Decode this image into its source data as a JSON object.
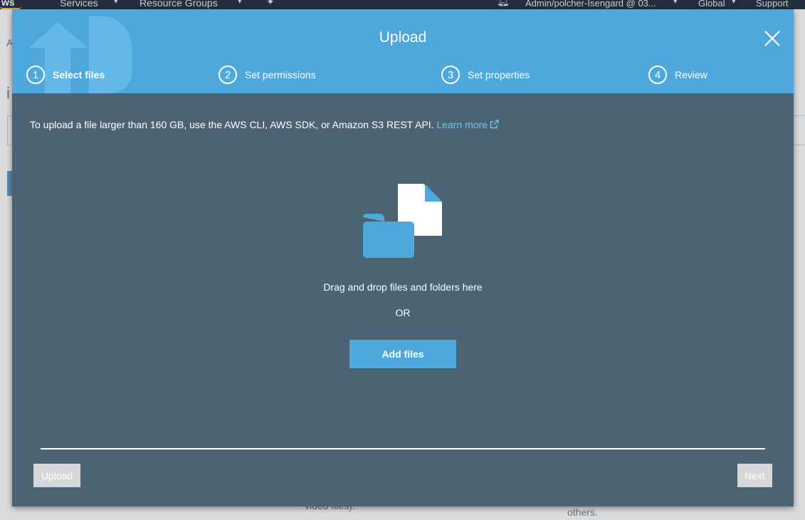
{
  "console": {
    "logo_text": "ws",
    "nav": [
      "Services",
      "Resource Groups"
    ],
    "account": "Admin/polcher-Isengard @ 03...",
    "region": "Global",
    "support": "Support",
    "bg_fragments": [
      "A",
      "i",
      "video files).",
      "others."
    ]
  },
  "modal": {
    "title": "Upload",
    "steps": [
      {
        "number": "1",
        "label": "Select files",
        "active": true
      },
      {
        "number": "2",
        "label": "Set permissions",
        "active": false
      },
      {
        "number": "3",
        "label": "Set properties",
        "active": false
      },
      {
        "number": "4",
        "label": "Review",
        "active": false
      }
    ],
    "info_text": "To upload a file larger than 160 GB, use the AWS CLI, AWS SDK, or Amazon S3 REST API.",
    "learn_more": "Learn more",
    "drop_text": "Drag and drop files and folders here",
    "or_text": "OR",
    "add_files_label": "Add files",
    "upload_label": "Upload",
    "next_label": "Next"
  },
  "colors": {
    "header_blue": "#4ea8dc",
    "modal_body": "#4c6373",
    "link": "#6fc5f0",
    "disabled_button": "#d5d7d9",
    "console_bar": "#232f3e"
  },
  "icons": [
    "upload-arrow-icon",
    "close-icon",
    "external-link-icon",
    "folder-icon",
    "document-icon",
    "bell-icon",
    "pin-icon",
    "caret-down-icon"
  ]
}
